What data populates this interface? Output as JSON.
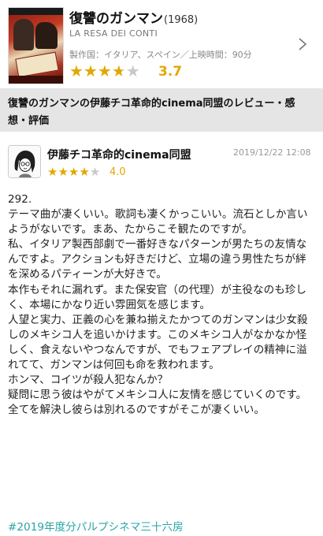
{
  "movie": {
    "title": "復讐のガンマン",
    "year": "(1968)",
    "original_title": "LA RESA DEI CONTI",
    "meta": "製作国：イタリア、スペイン／上映時間：90分",
    "rating": 3.7,
    "rating_text": "3.7",
    "star_color": "#e0a800",
    "star_empty_color": "#c8c8c8"
  },
  "section": {
    "title": "復讐のガンマンの伊藤チコ革命的cinema同盟のレビュー・感想・評価"
  },
  "review": {
    "author": "伊藤チコ革命的cinema同盟",
    "date": "2019/12/22 12:08",
    "rating": 4.0,
    "rating_text": "4.0",
    "body": "292.\nテーマ曲が凄くいい。歌詞も凄くかっこいい。流石としか言いようがないです。まあ、たからこそ観たのですが。\n私、イタリア製西部劇で一番好きなパターンが男たちの友情なんですよ。アクションも好きだけど、立場の違う男性たちが絆を深めるパティーンが大好きで。\n本作もそれに漏れず。また保安官（の代理）が主役なのも珍しく、本場にかなり近い雰囲気を感じます。\n人望と実力、正義の心を兼ね揃えたかつてのガンマンは少女殺しのメキシコ人を追いかけます。このメキシコ人がなかなか怪しく、食えないやつなんですが、でもフェアプレイの精神に溢れてて、ガンマンは何回も命を救われます。\nホンマ、コイツが殺人犯なんか？\n疑問に思う彼はやがてメキシコ人に友情を感じていくのです。全てを解決し彼らは別れるのですがそこが凄くいい。",
    "hashtag": "#2019年度分パルプシネマ三十六房",
    "hashtag_color": "#2aa5a5"
  }
}
